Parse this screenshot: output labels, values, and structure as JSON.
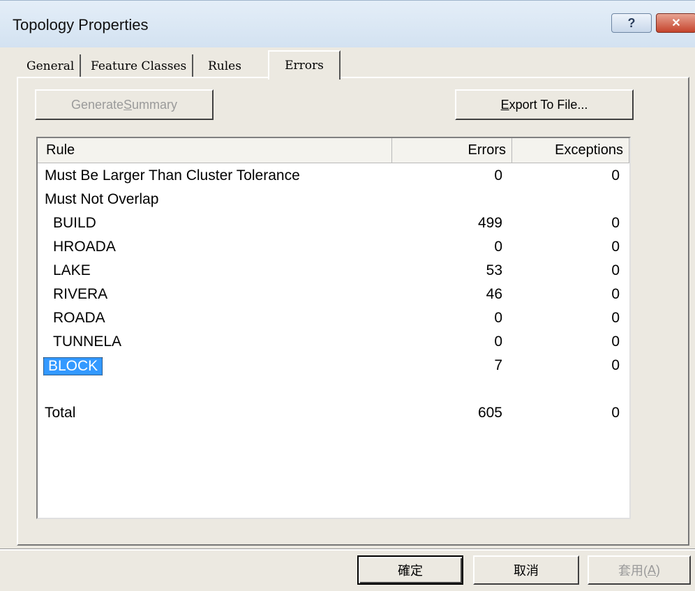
{
  "window": {
    "title": "Topology Properties"
  },
  "titlebar": {
    "help_label": "?",
    "close_label": "✕"
  },
  "tabs": [
    {
      "label": "General"
    },
    {
      "label": "Feature Classes"
    },
    {
      "label": "Rules"
    },
    {
      "label": "Errors",
      "active": true
    }
  ],
  "toolbar": {
    "generate_prefix": "Generate ",
    "generate_underlined": "S",
    "generate_suffix": "ummary",
    "export_underlined": "E",
    "export_suffix": "xport To File..."
  },
  "table": {
    "columns": [
      "Rule",
      "Errors",
      "Exceptions"
    ],
    "rows": [
      {
        "rule": "Must Be Larger Than Cluster Tolerance",
        "errors": "0",
        "exceptions": "0"
      },
      {
        "rule": "Must Not Overlap",
        "errors": "",
        "exceptions": ""
      },
      {
        "rule": "BUILD",
        "errors": "499",
        "exceptions": "0"
      },
      {
        "rule": "HROADA",
        "errors": "0",
        "exceptions": "0"
      },
      {
        "rule": "LAKE",
        "errors": "53",
        "exceptions": "0"
      },
      {
        "rule": "RIVERA",
        "errors": "46",
        "exceptions": "0"
      },
      {
        "rule": "ROADA",
        "errors": "0",
        "exceptions": "0"
      },
      {
        "rule": "TUNNELA",
        "errors": "0",
        "exceptions": "0"
      },
      {
        "rule": "BLOCK",
        "errors": "7",
        "exceptions": "0",
        "selected": true
      }
    ],
    "total": {
      "rule": "Total",
      "errors": "605",
      "exceptions": "0"
    }
  },
  "buttons": {
    "ok": "確定",
    "cancel": "取消",
    "apply_prefix": "套用(",
    "apply_underlined": "A",
    "apply_suffix": ")"
  }
}
